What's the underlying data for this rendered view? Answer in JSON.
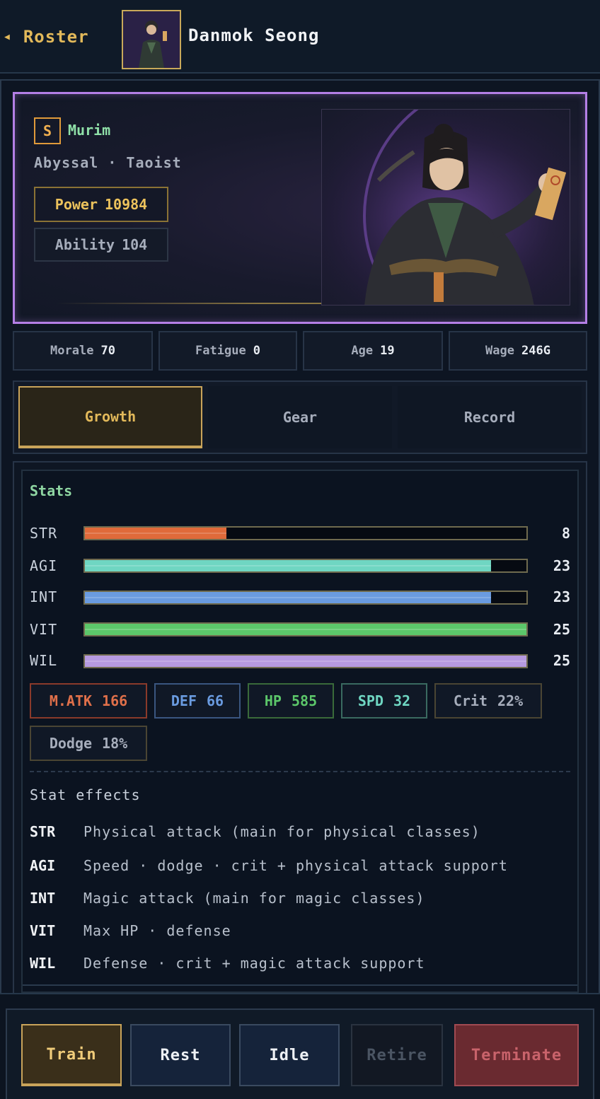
{
  "header": {
    "back_label": "Roster",
    "back_icon": "triangle-left-icon",
    "character_name": "Danmok Seong"
  },
  "profile": {
    "grade": "S",
    "faction": "Murim",
    "subtitle": "Abyssal · Taoist",
    "power_label": "Power",
    "power_value": "10984",
    "ability_label": "Ability",
    "ability_value": "104",
    "frame_color": "#b47fe6"
  },
  "status": [
    {
      "label": "Morale",
      "value": "70"
    },
    {
      "label": "Fatigue",
      "value": "0"
    },
    {
      "label": "Age",
      "value": "19"
    },
    {
      "label": "Wage",
      "value": "246G"
    }
  ],
  "tabs": [
    {
      "label": "Growth",
      "active": true
    },
    {
      "label": "Gear",
      "active": false
    },
    {
      "label": "Record",
      "active": false
    }
  ],
  "stats": {
    "title": "Stats",
    "max": 25,
    "items": [
      {
        "key": "STR",
        "value": 8,
        "color": "#e06a3a"
      },
      {
        "key": "AGI",
        "value": 23,
        "color": "#6fd6c2"
      },
      {
        "key": "INT",
        "value": 23,
        "color": "#6a9be0"
      },
      {
        "key": "VIT",
        "value": 25,
        "color": "#5cc76a"
      },
      {
        "key": "WIL",
        "value": 25,
        "color": "#b69ae0"
      }
    ],
    "derived": [
      {
        "label": "M.ATK",
        "value": "166",
        "color": "#e0704a",
        "border": "#8a3a2a"
      },
      {
        "label": "DEF",
        "value": "66",
        "color": "#6a9be0",
        "border": "#3a5680"
      },
      {
        "label": "HP",
        "value": "585",
        "color": "#5cc76a",
        "border": "#3a6a3a"
      },
      {
        "label": "SPD",
        "value": "32",
        "color": "#6fd6c2",
        "border": "#3a6a60"
      },
      {
        "label": "Crit",
        "value": "22%",
        "color": "#a6adbb",
        "border": "#4a4533"
      },
      {
        "label": "Dodge",
        "value": "18%",
        "color": "#a6adbb",
        "border": "#4a4533"
      }
    ],
    "effects_title": "Stat effects",
    "effects": [
      {
        "key": "STR",
        "text": "Physical attack (main for physical classes)"
      },
      {
        "key": "AGI",
        "text": "Speed · dodge · crit + physical attack support"
      },
      {
        "key": "INT",
        "text": "Magic attack (main for magic classes)"
      },
      {
        "key": "VIT",
        "text": "Max HP · defense"
      },
      {
        "key": "WIL",
        "text": "Defense · crit + magic attack support"
      }
    ]
  },
  "actions": [
    {
      "label": "Train",
      "style": "train"
    },
    {
      "label": "Rest",
      "style": "normal"
    },
    {
      "label": "Idle",
      "style": "normal"
    },
    {
      "label": "Retire",
      "style": "retire"
    },
    {
      "label": "Terminate",
      "style": "terminate"
    }
  ]
}
